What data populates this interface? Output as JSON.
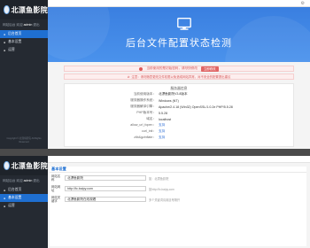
{
  "brand": {
    "name": "北漂鱼影院"
  },
  "welcome": {
    "prefix": "网站后台 欢迎",
    "user": "admin",
    "suffix": "退出"
  },
  "sidebar": {
    "items": [
      {
        "label": "后台首页"
      },
      {
        "label": "基本设置"
      },
      {
        "label": "运营"
      }
    ]
  },
  "copyright": "Copyright © 北漂鱼影院 All Rights Reserved",
  "hero": {
    "title": "后台文件配置状态检测"
  },
  "notices": {
    "first": "当前使用的是初始密码，请尽快修改",
    "first_button": "立即修改",
    "second": "注意：请勿随意更改文件权限以免造成网站异常，对不安全的配置提出建议"
  },
  "info": {
    "title": "服务器信息",
    "rows": [
      {
        "k": "当前使用版本：",
        "v": "北漂鱼影院V3.8版本"
      },
      {
        "k": "服务器操作系统：",
        "v": "Windows (NT)"
      },
      {
        "k": "服务器解译引擎：",
        "v": "Apache/2.4.18 (Win32) OpenSSL/1.0.2e PHP/5.5.28"
      },
      {
        "k": "PHP版本号：",
        "v": "5.5.28"
      },
      {
        "k": "域名：",
        "v": "localhost"
      },
      {
        "k": "allow_url_fopen：",
        "v": "支持"
      },
      {
        "k": "curl_init：",
        "v": "支持"
      },
      {
        "k": "zlib&gzinflate：",
        "v": "支持"
      }
    ]
  },
  "form": {
    "title": "基本设置",
    "rows": [
      {
        "label": "网站名称",
        "value": "北漂鱼影院",
        "hint": "如：北漂鱼影院"
      },
      {
        "label": "网站网址",
        "value": "http://fc.baipy.com",
        "hint": "如http://fc.baipy.com"
      },
      {
        "label": "网站关键字",
        "value": "北漂鱼影院在线观看",
        "hint": "多个关键词请用逗号隔开"
      }
    ]
  }
}
